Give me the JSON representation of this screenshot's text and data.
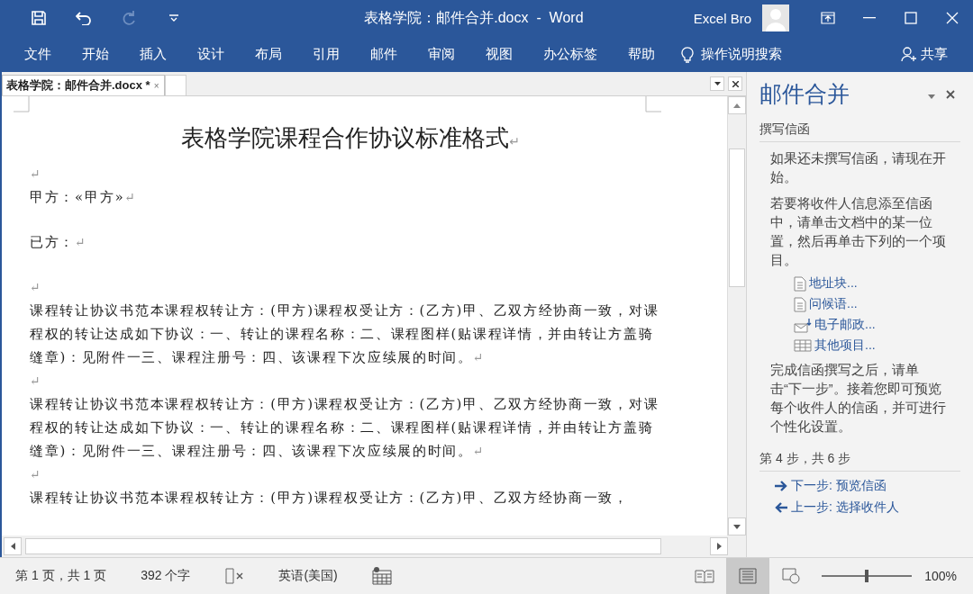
{
  "quick_access": [
    {
      "kind": "save",
      "disabled": false
    },
    {
      "kind": "undo",
      "disabled": false
    },
    {
      "kind": "redo",
      "disabled": true
    },
    {
      "kind": "customize",
      "disabled": false
    }
  ],
  "window": {
    "title": "表格学院：邮件合并.docx  -  Word",
    "user": "Excel Bro"
  },
  "ribbon_tabs": [
    "文件",
    "开始",
    "插入",
    "设计",
    "布局",
    "引用",
    "邮件",
    "审阅",
    "视图",
    "办公标签",
    "帮助"
  ],
  "search": {
    "placeholder": "操作说明搜索"
  },
  "share": "共享",
  "document_tab": {
    "label": "表格学院：邮件合并.docx *",
    "close": "×"
  },
  "document": {
    "heading": "表格学院课程合作协议标准格式",
    "heading_mark": "↵",
    "paragraphs": [
      {
        "kind": "blank",
        "mark": "↵"
      },
      {
        "kind": "line",
        "text": "甲方：«甲方»",
        "mark": "↵"
      },
      {
        "kind": "line",
        "text": "已方：",
        "mark": "↵"
      },
      {
        "kind": "blank",
        "mark": "↵"
      },
      {
        "kind": "body",
        "text": "课程转让协议书范本课程权转让方：(甲方)课程权受让方：(乙方)甲、乙双方经协商一致，对课程权的转让达成如下协议：一、转让的课程名称：二、课程图样(贴课程详情，并由转让方盖骑缝章)：见附件一三、课程注册号：四、该课程下次应续展的时间。",
        "mark": "↵"
      },
      {
        "kind": "blank",
        "mark": "↵"
      },
      {
        "kind": "body",
        "text": "课程转让协议书范本课程权转让方：(甲方)课程权受让方：(乙方)甲、乙双方经协商一致，对课程权的转让达成如下协议：一、转让的课程名称：二、课程图样(贴课程详情，并由转让方盖骑缝章)：见附件一三、课程注册号：四、该课程下次应续展的时间。",
        "mark": "↵"
      },
      {
        "kind": "blank",
        "mark": "↵"
      },
      {
        "kind": "body",
        "text": "课程转让协议书范本课程权转让方：(甲方)课程权受让方：(乙方)甲、乙双方经协商一致，"
      }
    ]
  },
  "task_pane": {
    "title": "邮件合并",
    "section": "撰写信函",
    "intro": [
      "如果还未撰写信函，请现在开始。",
      "若要将收件人信息添至信函中，请单击文档中的某一位置，然后再单击下列的一个项目。"
    ],
    "links": [
      {
        "kind": "address",
        "label": "地址块..."
      },
      {
        "kind": "greeting",
        "label": "问候语..."
      },
      {
        "kind": "postage",
        "label": "电子邮政..."
      },
      {
        "kind": "more",
        "label": "其他项目..."
      }
    ],
    "outro": "完成信函撰写之后，请单击“下一步”。接着您即可预览每个收件人的信函，并可进行个性化设置。",
    "step": "第 4 步，共 6 步",
    "nav": [
      {
        "kind": "next",
        "label": "下一步: 预览信函"
      },
      {
        "kind": "prev",
        "label": "上一步: 选择收件人"
      }
    ]
  },
  "status_bar": {
    "page": "第 1 页，共 1 页",
    "words": "392 个字",
    "language": "英语(美国)",
    "views": [
      {
        "kind": "read",
        "selected": false
      },
      {
        "kind": "print",
        "selected": true
      },
      {
        "kind": "web",
        "selected": false
      }
    ],
    "zoom": {
      "level": 0.5,
      "reading": "100%"
    }
  }
}
